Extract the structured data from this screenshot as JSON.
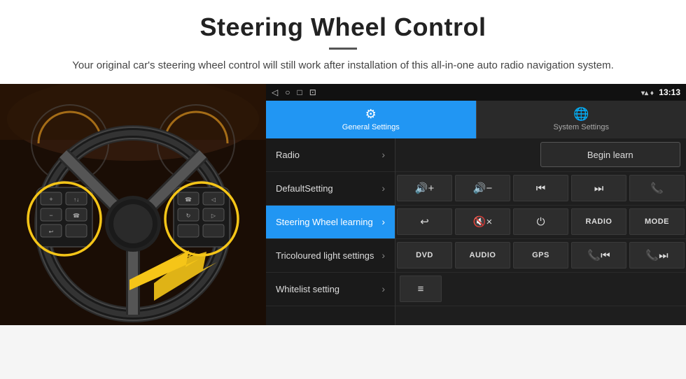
{
  "header": {
    "title": "Steering Wheel Control",
    "description": "Your original car's steering wheel control will still work after installation of this all-in-one auto radio navigation system."
  },
  "status_bar": {
    "nav_back": "◁",
    "nav_home": "○",
    "nav_recent": "□",
    "nav_extra": "⊡",
    "time": "13:13",
    "signal_icon": "signal-icon",
    "wifi_icon": "wifi-icon"
  },
  "tabs": [
    {
      "id": "general",
      "label": "General Settings",
      "active": true
    },
    {
      "id": "system",
      "label": "System Settings",
      "active": false
    }
  ],
  "menu_items": [
    {
      "id": "radio",
      "label": "Radio",
      "active": false
    },
    {
      "id": "default-setting",
      "label": "DefaultSetting",
      "active": false
    },
    {
      "id": "steering-wheel",
      "label": "Steering Wheel learning",
      "active": true
    },
    {
      "id": "tricoloured",
      "label": "Tricoloured light settings",
      "active": false
    },
    {
      "id": "whitelist",
      "label": "Whitelist setting",
      "active": false
    }
  ],
  "right_panel": {
    "begin_learn_label": "Begin learn",
    "button_rows": [
      [
        {
          "id": "vol-up",
          "icon": "🔊+",
          "type": "icon"
        },
        {
          "id": "vol-down",
          "icon": "🔊-",
          "type": "icon"
        },
        {
          "id": "prev-track",
          "icon": "⏮",
          "type": "icon"
        },
        {
          "id": "next-track",
          "icon": "⏭",
          "type": "icon"
        },
        {
          "id": "phone",
          "icon": "📞",
          "type": "icon"
        }
      ],
      [
        {
          "id": "hang-up",
          "icon": "↩",
          "type": "icon"
        },
        {
          "id": "mute",
          "icon": "🔇×",
          "type": "icon"
        },
        {
          "id": "power",
          "icon": "⏻",
          "type": "icon"
        },
        {
          "id": "radio-btn",
          "label": "RADIO",
          "type": "text"
        },
        {
          "id": "mode-btn",
          "label": "MODE",
          "type": "text"
        }
      ],
      [
        {
          "id": "dvd-btn",
          "label": "DVD",
          "type": "text"
        },
        {
          "id": "audio-btn",
          "label": "AUDIO",
          "type": "text"
        },
        {
          "id": "gps-btn",
          "label": "GPS",
          "type": "text"
        },
        {
          "id": "phone-prev",
          "icon": "📞⏮",
          "type": "icon"
        },
        {
          "id": "phone-next",
          "icon": "📞⏭",
          "type": "icon"
        }
      ],
      [
        {
          "id": "extra-btn",
          "icon": "≡",
          "type": "icon"
        }
      ]
    ]
  }
}
